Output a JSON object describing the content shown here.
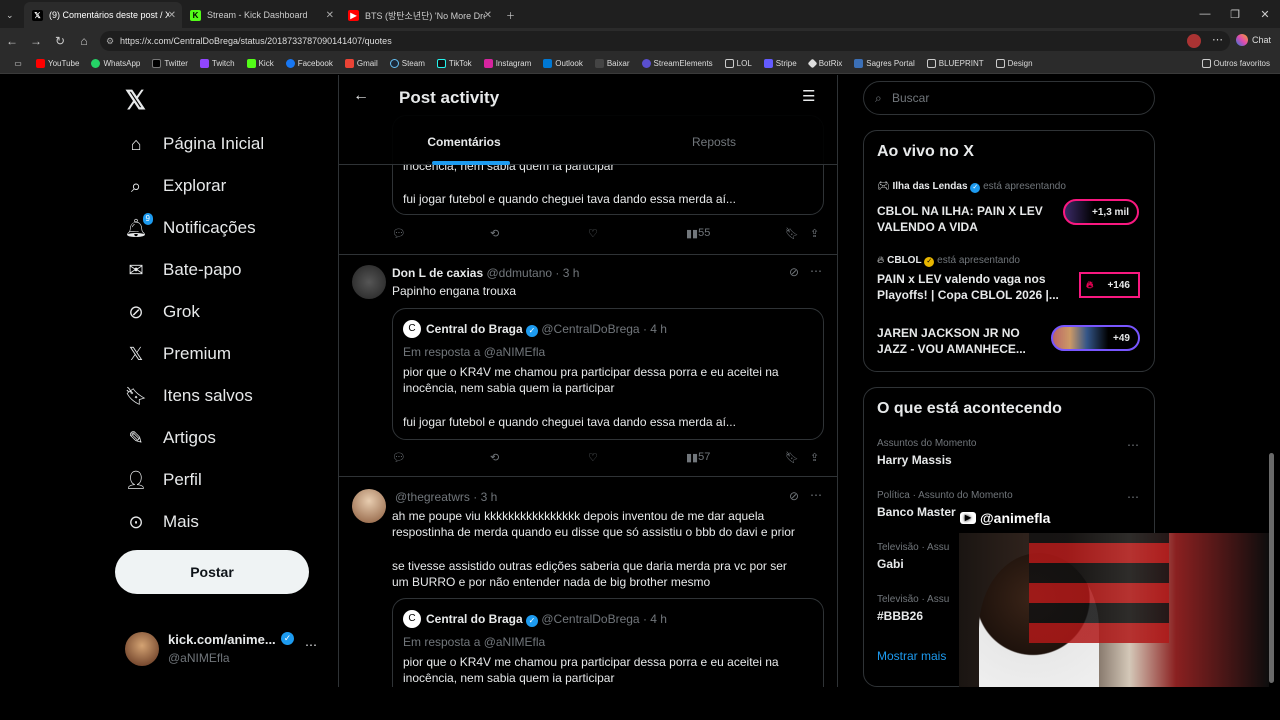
{
  "browser": {
    "tabs": [
      {
        "label": "(9) Comentários deste post / X",
        "icon": "x-icon",
        "active": true
      },
      {
        "label": "Stream - Kick Dashboard",
        "icon": "kick-icon",
        "active": false
      },
      {
        "label": "BTS (방탄소년단) 'No More Dream'",
        "icon": "youtube-icon",
        "active": false
      }
    ],
    "url": "https://x.com/CentralDoBrega/status/2018733787090141407/quotes",
    "chat_label": "Chat",
    "bookmarks": [
      "YouTube",
      "WhatsApp",
      "Twitter",
      "Twitch",
      "Kick",
      "Facebook",
      "Gmail",
      "Steam",
      "TikTok",
      "Instagram",
      "Outlook",
      "Baixar",
      "StreamElements",
      "LOL",
      "Stripe",
      "BotRix",
      "Sagres Portal",
      "BLUEPRINT",
      "Design"
    ],
    "other_bookmarks": "Outros favoritos"
  },
  "nav": {
    "items": [
      {
        "label": "Página Inicial",
        "icon": "home-icon"
      },
      {
        "label": "Explorar",
        "icon": "search-icon"
      },
      {
        "label": "Notificações",
        "icon": "bell-icon",
        "badge": "9"
      },
      {
        "label": "Bate-papo",
        "icon": "mail-icon"
      },
      {
        "label": "Grok",
        "icon": "grok-icon"
      },
      {
        "label": "Premium",
        "icon": "x-icon"
      },
      {
        "label": "Itens salvos",
        "icon": "bookmark-icon"
      },
      {
        "label": "Artigos",
        "icon": "article-icon"
      },
      {
        "label": "Perfil",
        "icon": "person-icon"
      },
      {
        "label": "Mais",
        "icon": "more-icon"
      }
    ],
    "post_button": "Postar",
    "account": {
      "name": "kick.com/anime...",
      "handle": "@aNIMEfla"
    }
  },
  "center": {
    "title": "Post activity",
    "tabs": [
      "Comentários",
      "Reposts"
    ],
    "partial_top": {
      "line1": "inocência, nem sabia quem ia participar",
      "line2": "fui jogar futebol e quando cheguei tava dando essa merda aí...",
      "views": "55"
    },
    "tweets": [
      {
        "name": "Don L de caxias",
        "handle": "@ddmutano",
        "time": "· 3 h",
        "text": "Papinho engana trouxa",
        "quote": {
          "name": "Central do Braga",
          "handle": "@CentralDoBrega",
          "time": "· 4 h",
          "reply": "Em resposta a @aNIMEfla",
          "line1": "pior que o KR4V me chamou pra participar dessa porra e eu aceitei na",
          "line2": "inocência, nem sabia quem ia participar",
          "line3": "fui jogar futebol e quando cheguei tava dando essa merda aí..."
        },
        "views": "57"
      },
      {
        "name": "",
        "handle": "@thegreatwrs",
        "time": "· 3 h",
        "line1": "ah me poupe viu kkkkkkkkkkkkkkkk depois inventou de me dar aquela",
        "line2": "respostinha de merda quando eu disse que só assistiu o bbb do davi e prior",
        "line3": "se tivesse assistido outras edições saberia que daria merda pra vc por ser",
        "line4": "um BURRO e por não entender nada de big brother mesmo",
        "quote": {
          "name": "Central do Braga",
          "handle": "@CentralDoBrega",
          "time": "· 4 h",
          "reply": "Em resposta a @aNIMEfla",
          "line1": "pior que o KR4V me chamou pra participar dessa porra e eu aceitei na",
          "line2": "inocência, nem sabia quem ia participar"
        }
      }
    ]
  },
  "right": {
    "search_placeholder": "Buscar",
    "live": {
      "title": "Ao vivo no X",
      "items": [
        {
          "host": "Ilha das Lendas",
          "status": "está apresentando",
          "title1": "CBLOL NA ILHA: PAIN X LEV",
          "title2": "VALENDO A VIDA",
          "count": "+1,3 mil"
        },
        {
          "host": "CBLOL",
          "status": "está apresentando",
          "title1": "PAIN x LEV valendo vaga nos",
          "title2": "Playoffs! | Copa CBLOL 2026 |...",
          "count": "+146"
        },
        {
          "host": "",
          "status": "",
          "title1": "JAREN JACKSON JR NO",
          "title2": "JAZZ - VOU AMANHECE...",
          "count": "+49"
        }
      ]
    },
    "trends": {
      "title": "O que está acontecendo",
      "items": [
        {
          "context": "Assuntos do Momento",
          "name": "Harry Massis"
        },
        {
          "context": "Política · Assunto do Momento",
          "name": "Banco Master"
        },
        {
          "context": "Televisão · Assu",
          "name": "Gabi"
        },
        {
          "context": "Televisão · Assu",
          "name": "#BBB26"
        }
      ],
      "show_more": "Mostrar mais"
    }
  },
  "overlay": {
    "channel": "@animefla"
  }
}
